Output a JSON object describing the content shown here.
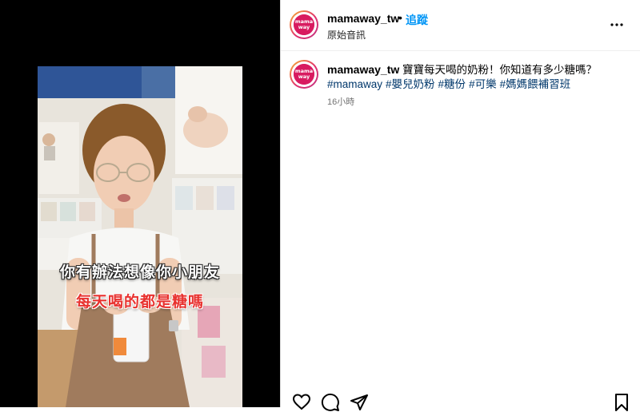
{
  "header": {
    "username": "mamaway_tw",
    "separator": "•",
    "follow_label": "追蹤",
    "audio_label": "原始音訊",
    "more_icon": "more-horizontal-icon"
  },
  "avatar": {
    "logo_text_top": "mama",
    "logo_text_bottom": "way",
    "brand_color": "#d81b60"
  },
  "video": {
    "subtitle_line1": "你有辦法想像你小朋友",
    "subtitle_line2": "每天喝的都是糖嗎"
  },
  "caption": {
    "username": "mamaway_tw",
    "text": "寶寶每天喝的奶粉！你知道有多少糖嗎？",
    "hashtags": [
      "#mamaway",
      "#嬰兒奶粉",
      "#糖份",
      "#可樂",
      "#媽媽餵補習班"
    ],
    "time": "16小時"
  },
  "actions": {
    "like_icon": "heart-icon",
    "comment_icon": "comment-icon",
    "share_icon": "send-icon",
    "save_icon": "bookmark-icon"
  },
  "colors": {
    "link_blue": "#0095f6",
    "hashtag_blue": "#00376b",
    "subtitle_red": "#e8322f"
  }
}
